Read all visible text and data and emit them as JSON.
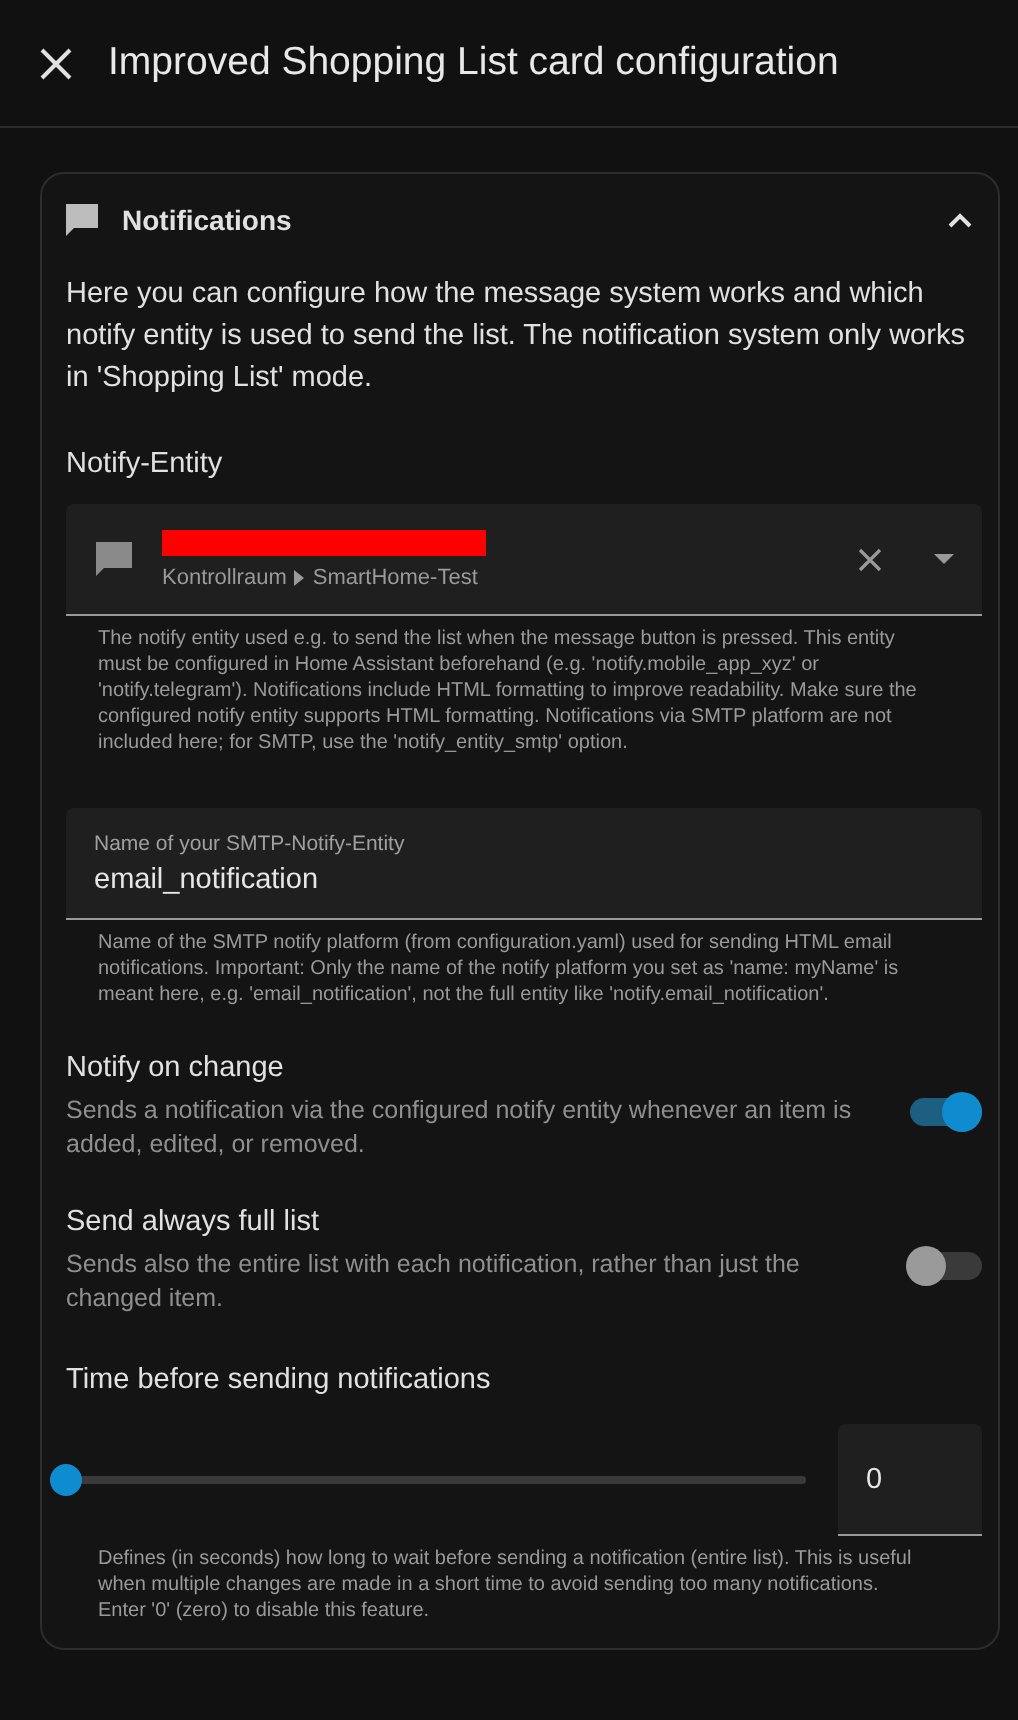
{
  "dialog": {
    "title": "Improved Shopping List card configuration"
  },
  "section": {
    "title": "Notifications",
    "expanded": true,
    "intro": "Here you can configure how the message system works and which notify entity is used to send the list. The notification system only works in 'Shopping List' mode.",
    "entity_label": "Notify-Entity",
    "entity_picker": {
      "area": "Kontrollraum",
      "device": "SmartHome-Test",
      "helper": "The notify entity used e.g. to send the list when the message button is pressed. This entity must be configured in Home Assistant beforehand (e.g. 'notify.mobile_app_xyz' or 'notify.telegram'). Notifications include HTML formatting to improve readability. Make sure the configured notify entity supports HTML formatting. Notifications via SMTP platform are not included here; for SMTP, use the 'notify_entity_smtp' option."
    },
    "smtp_field": {
      "label": "Name of your SMTP-Notify-Entity",
      "value": "email_notification",
      "helper": "Name of the SMTP notify platform (from configuration.yaml) used for sending HTML email notifications. Important: Only the name of the notify platform you set as 'name: myName' is meant here, e.g. 'email_notification', not the full entity like 'notify.email_notification'."
    },
    "toggles": [
      {
        "title": "Notify on change",
        "description": "Sends a notification via the configured notify entity whenever an item is added, edited, or removed.",
        "on": true
      },
      {
        "title": "Send always full list",
        "description": "Sends also the entire list with each notification, rather than just the changed item.",
        "on": false
      }
    ],
    "delay": {
      "title": "Time before sending notifications",
      "level": 0,
      "value": "0",
      "helper": "Defines (in seconds) how long to wait before sending a notification (entire list). This is useful when multiple changes are made in a short time to avoid sending too many notifications. Enter '0' (zero) to disable this feature."
    }
  }
}
